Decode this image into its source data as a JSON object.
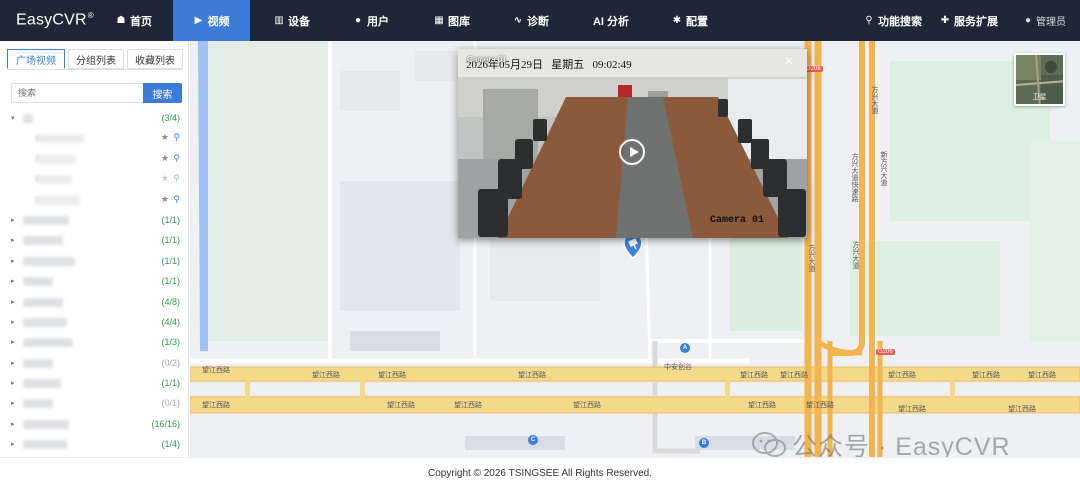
{
  "app": {
    "brand": "EasyCVR",
    "brand_mark": "®"
  },
  "nav": {
    "items": [
      {
        "label": "首页",
        "icon": "home-icon"
      },
      {
        "label": "视频",
        "icon": "play-circle-icon",
        "active": true
      },
      {
        "label": "设备",
        "icon": "device-icon"
      },
      {
        "label": "用户",
        "icon": "user-icon"
      },
      {
        "label": "图库",
        "icon": "gallery-icon"
      },
      {
        "label": "诊断",
        "icon": "pulse-icon"
      },
      {
        "label": "AI 分析",
        "icon": "ai-icon"
      },
      {
        "label": "配置",
        "icon": "gear-icon"
      }
    ],
    "function_search": "功能搜索",
    "service_ext": "服务扩展",
    "user": "管理员"
  },
  "sidebar": {
    "tabs": [
      "广场视频",
      "分组列表",
      "收藏列表"
    ],
    "search_placeholder": "搜索",
    "search_button": "搜索",
    "tree": [
      {
        "count": "(3/4)",
        "expanded": true
      },
      {
        "child": true,
        "star": true
      },
      {
        "child": true,
        "star": true
      },
      {
        "child": true,
        "star": true,
        "light": true
      },
      {
        "child": true,
        "star": true
      },
      {
        "count": "(1/1)"
      },
      {
        "count": "(1/1)"
      },
      {
        "count": "(1/1)"
      },
      {
        "count": "(1/1)"
      },
      {
        "count": "(4/8)"
      },
      {
        "count": "(4/4)"
      },
      {
        "count": "(1/3)"
      },
      {
        "count": "(0/2)",
        "gray": true
      },
      {
        "count": "(1/1)"
      },
      {
        "count": "(0/1)",
        "gray": true
      },
      {
        "count": "(16/16)"
      },
      {
        "count": "(1/4)"
      }
    ]
  },
  "map": {
    "roads": {
      "wangjiang_labels": [
        "望江西路",
        "望江西路",
        "望江西路",
        "望江西路",
        "望江西路",
        "望江西路",
        "望江西路",
        "望江西路",
        "望江西路",
        "望江西路",
        "望江西路",
        "望江西路",
        "望江西路",
        "望江西路",
        "望江西路",
        "望江西路",
        "望江西路"
      ],
      "fangxing_labels": [
        "方兴大道",
        "方兴大道快速路",
        "方兴大道",
        "方兴大道",
        "新方兴大道"
      ],
      "zhonganchuanggu": "中安创谷"
    },
    "poi_markers": [
      "A",
      "B",
      "C"
    ],
    "route_badges": [
      "G206",
      "G206"
    ],
    "satellite_label": "卫星"
  },
  "video": {
    "camera_title": "Camera 01",
    "osd_date": "2026年05月29日   星期五   09:02:49",
    "osd_camera": "Camera 01"
  },
  "watermark": "公众号 · EasyCVR",
  "footer": {
    "copyright": "Copyright © 2026 TSINGSEE All Rights Reserved."
  },
  "colors": {
    "nav_bg": "#1f2637",
    "accent": "#3d7bd9",
    "count_green": "#2f9d4a",
    "road_yellow": "#f5d98a",
    "road_orange": "#f3b34f"
  }
}
